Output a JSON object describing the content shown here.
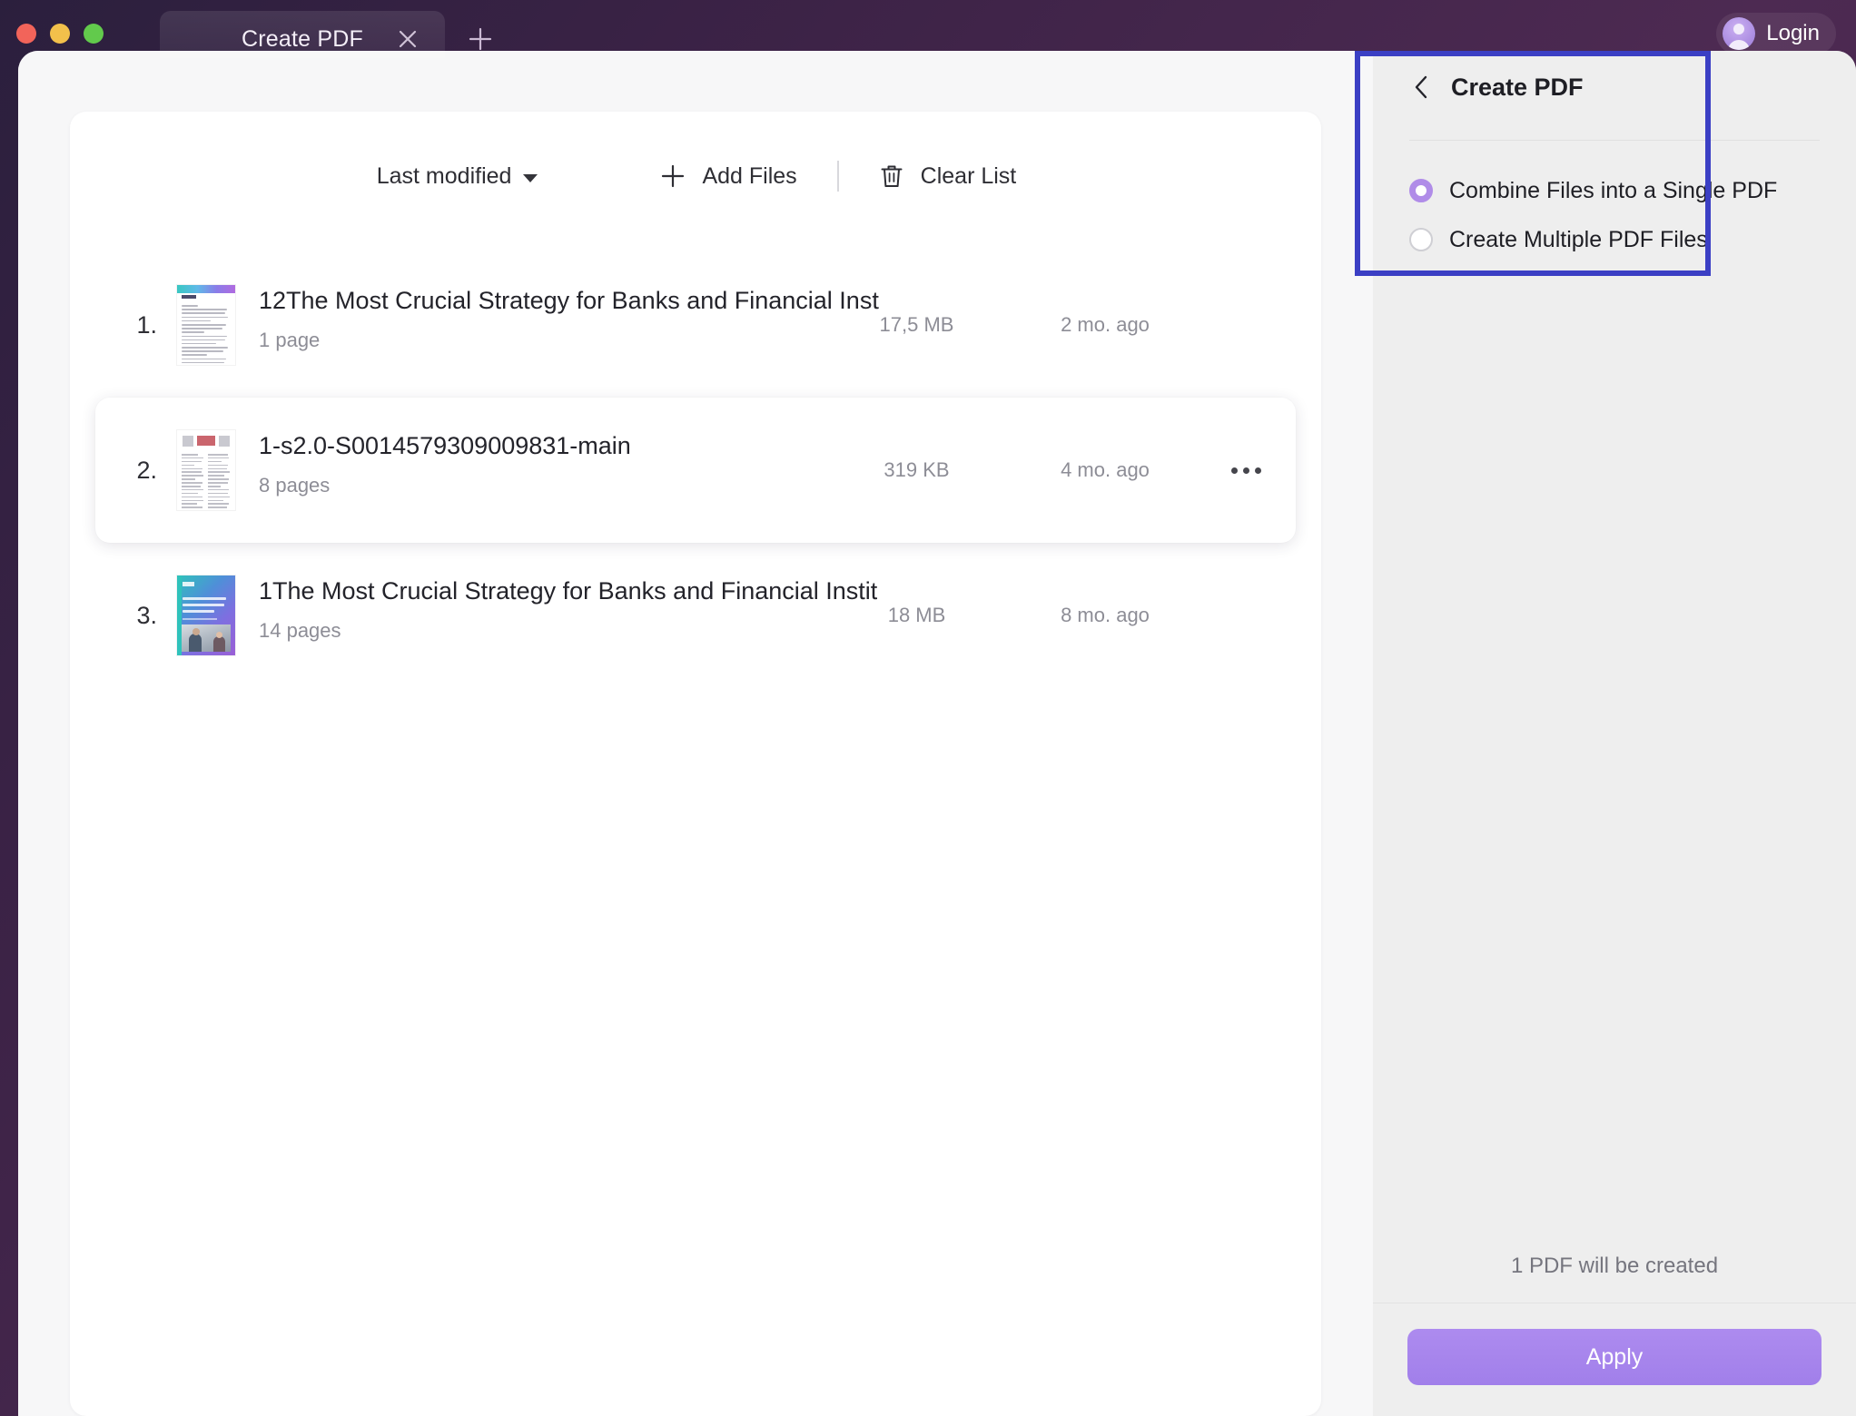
{
  "window": {
    "traffic_lights": [
      "close",
      "minimize",
      "zoom"
    ]
  },
  "titlebar": {
    "tab_label": "Create PDF",
    "close_tab_icon": "close-icon",
    "new_tab_icon": "plus-icon",
    "login_label": "Login",
    "avatar_icon": "user-avatar-icon"
  },
  "toolbar": {
    "sort_label": "Last modified",
    "sort_caret_icon": "chevron-down-icon",
    "add_files_label": "Add Files",
    "add_files_icon": "plus-icon",
    "clear_list_label": "Clear List",
    "clear_list_icon": "trash-icon"
  },
  "files": [
    {
      "index": "1.",
      "name": "12The Most Crucial Strategy for Banks and Financial Inst",
      "pages": "1 page",
      "size": "17,5 MB",
      "modified": "2 mo. ago",
      "selected": false,
      "thumb": "doc-text-thumbnail"
    },
    {
      "index": "2.",
      "name": "1-s2.0-S0014579309009831-main",
      "pages": "8 pages",
      "size": "319 KB",
      "modified": "4 mo. ago",
      "selected": true,
      "thumb": "paper-thumbnail"
    },
    {
      "index": "3.",
      "name": "1The Most Crucial Strategy for Banks and Financial Instit",
      "pages": "14 pages",
      "size": "18 MB",
      "modified": "8 mo. ago",
      "selected": false,
      "thumb": "cover-thumbnail"
    }
  ],
  "panel": {
    "back_icon": "chevron-left-icon",
    "title": "Create PDF",
    "options": [
      {
        "label": "Combine Files into a Single PDF",
        "checked": true
      },
      {
        "label": "Create Multiple PDF Files",
        "checked": false
      }
    ],
    "status": "1 PDF will be created",
    "apply_label": "Apply"
  },
  "colors": {
    "accent_purple": "#a17fea",
    "highlight_blue": "#3b3fc4",
    "radio_purple": "#b08ce8",
    "titlebar_purple": "#3d2347",
    "panel_bg": "#eeeeee"
  }
}
